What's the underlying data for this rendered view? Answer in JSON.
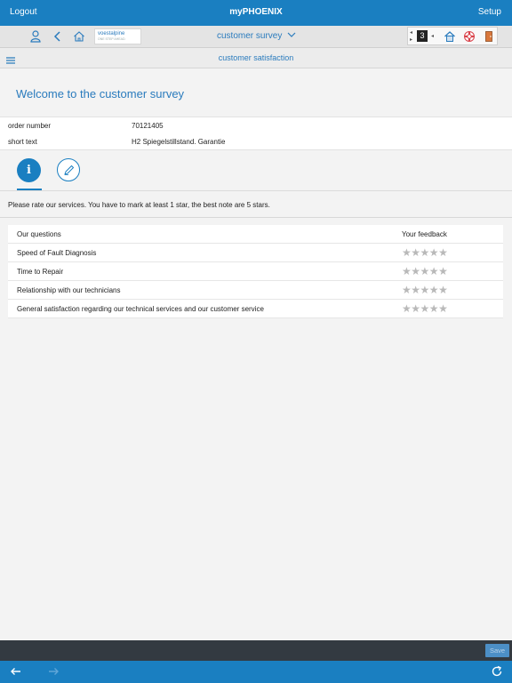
{
  "header": {
    "logout_label": "Logout",
    "app_title": "myPHOENIX",
    "setup_label": "Setup"
  },
  "toolbar": {
    "logo_text": "voestalpine",
    "logo_sub": "ONE STEP AHEAD.",
    "title": "customer survey",
    "widget_letter": "3"
  },
  "subbar": {
    "title": "customer satisfaction"
  },
  "main": {
    "welcome": "Welcome to the customer survey",
    "order": {
      "label": "order number",
      "value": "70121405"
    },
    "short_text": {
      "label": "short text",
      "value": "H2 Spiegelstillstand. Garantie"
    },
    "tab_info_glyph": "i",
    "instructions": "Please rate our services. You have to mark at least 1 star, the best note are 5 stars."
  },
  "questions": {
    "header_questions": "Our questions",
    "header_feedback": "Your feedback",
    "items": [
      {
        "question": "Speed of Fault Diagnosis",
        "rating": 0
      },
      {
        "question": "Time to Repair",
        "rating": 0
      },
      {
        "question": "Relationship with our technicians",
        "rating": 0
      },
      {
        "question": "General satisfaction regarding our technical services and our customer service",
        "rating": 0
      }
    ],
    "max_stars": 5
  },
  "footer": {
    "save_label": "Save"
  },
  "colors": {
    "accent": "#1a7fc1",
    "save_bar": "#333a41",
    "star_inactive": "#b9b9b9"
  },
  "icons": [
    "user-icon",
    "back-icon",
    "home-icon",
    "chevron-down-icon",
    "menu-icon",
    "info-icon",
    "edit-icon",
    "arrow-left-icon",
    "arrow-right-icon",
    "refresh-icon"
  ]
}
